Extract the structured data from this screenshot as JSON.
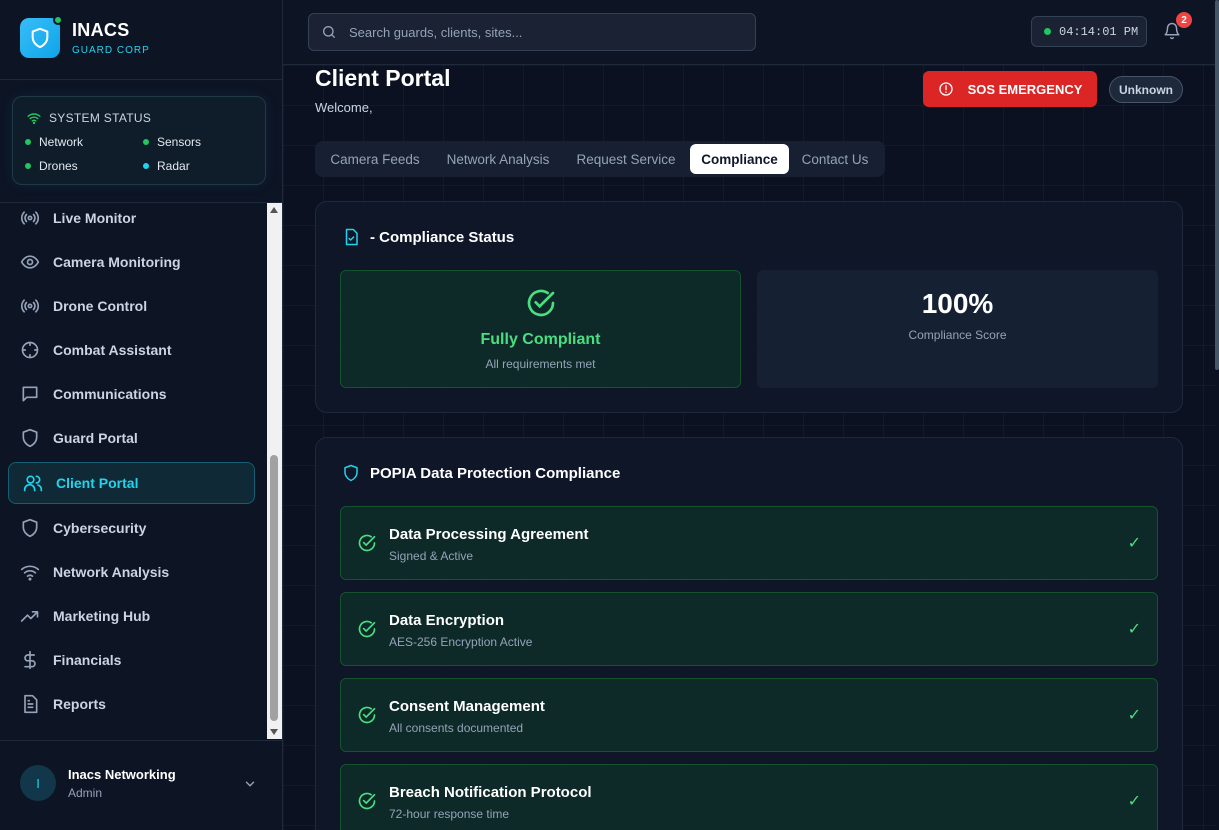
{
  "brand": {
    "title": "INACS",
    "subtitle": "GUARD CORP"
  },
  "system_status": {
    "title": "SYSTEM STATUS",
    "items": [
      {
        "label": "Network",
        "color": "#22c55e"
      },
      {
        "label": "Sensors",
        "color": "#22c55e"
      },
      {
        "label": "Drones",
        "color": "#22c55e"
      },
      {
        "label": "Radar",
        "color": "#22d3ee"
      }
    ]
  },
  "nav": {
    "items": [
      {
        "label": "Live Monitor",
        "icon": "broadcast-icon"
      },
      {
        "label": "Camera Monitoring",
        "icon": "eye-icon"
      },
      {
        "label": "Drone Control",
        "icon": "broadcast-icon"
      },
      {
        "label": "Combat Assistant",
        "icon": "crosshair-icon"
      },
      {
        "label": "Communications",
        "icon": "message-icon"
      },
      {
        "label": "Guard Portal",
        "icon": "shield-icon"
      },
      {
        "label": "Client Portal",
        "icon": "users-icon",
        "active": true
      },
      {
        "label": "Cybersecurity",
        "icon": "shield-icon"
      },
      {
        "label": "Network Analysis",
        "icon": "wifi-icon"
      },
      {
        "label": "Marketing Hub",
        "icon": "trending-up-icon"
      },
      {
        "label": "Financials",
        "icon": "dollar-icon"
      },
      {
        "label": "Reports",
        "icon": "file-text-icon"
      }
    ]
  },
  "user": {
    "initial": "I",
    "name": "Inacs Networking",
    "role": "Admin"
  },
  "header": {
    "search_placeholder": "Search guards, clients, sites...",
    "clock": "04:14:01 PM",
    "notification_count": "2"
  },
  "page": {
    "title": "Client Portal",
    "welcome": "Welcome,",
    "sos_label": "SOS EMERGENCY",
    "status_badge": "Unknown",
    "tabs": [
      {
        "label": "Camera Feeds"
      },
      {
        "label": "Network Analysis"
      },
      {
        "label": "Request Service"
      },
      {
        "label": "Compliance",
        "active": true
      },
      {
        "label": "Contact Us"
      }
    ]
  },
  "compliance_status": {
    "title": "- Compliance Status",
    "status_label": "Fully Compliant",
    "status_sub": "All requirements met",
    "score": "100%",
    "score_label": "Compliance Score"
  },
  "popia": {
    "title": "POPIA Data Protection Compliance",
    "items": [
      {
        "title": "Data Processing Agreement",
        "sub": "Signed & Active",
        "check": "✓"
      },
      {
        "title": "Data Encryption",
        "sub": "AES-256 Encryption Active",
        "check": "✓"
      },
      {
        "title": "Consent Management",
        "sub": "All consents documented",
        "check": "✓"
      },
      {
        "title": "Breach Notification Protocol",
        "sub": "72-hour response time",
        "check": "✓"
      }
    ]
  },
  "colors": {
    "accent": "#22d3ee",
    "success": "#4ade80",
    "danger": "#dc2626",
    "background": "#0b1120"
  }
}
